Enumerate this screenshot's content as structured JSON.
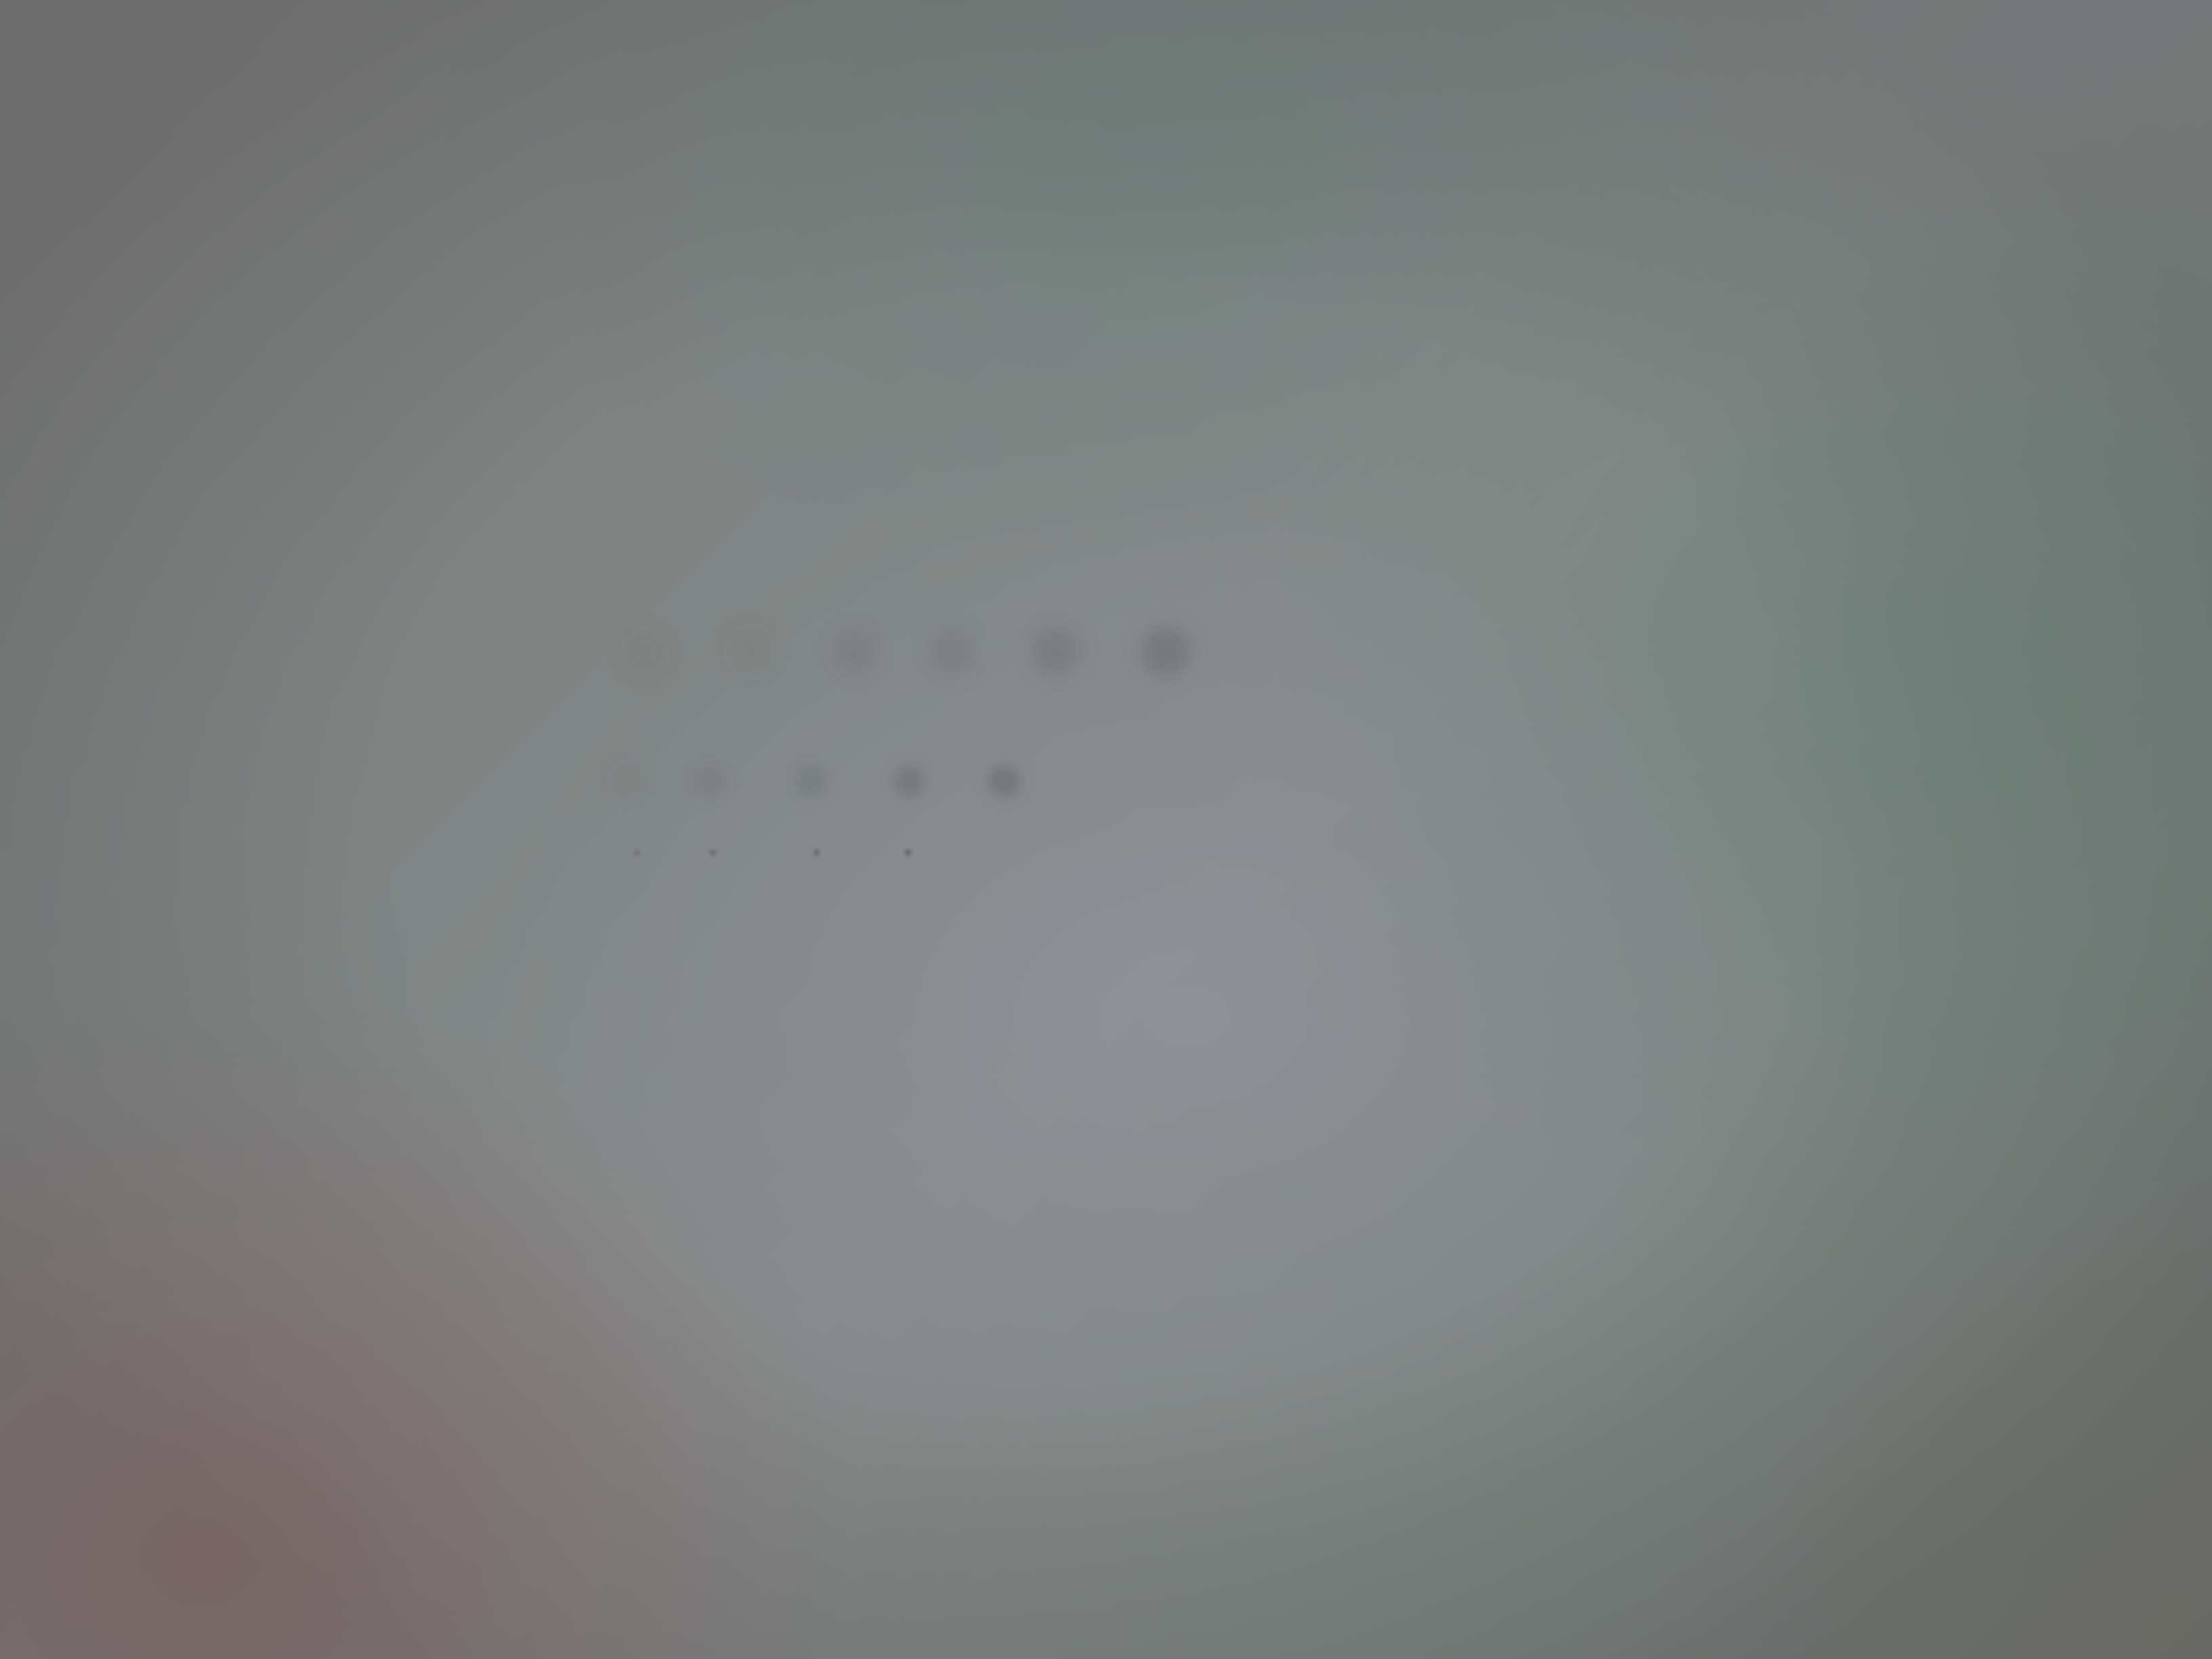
{
  "scene": {
    "description_tags": [
      "blurred-surface",
      "dot-pattern"
    ],
    "colors": {
      "base": "#808585",
      "dot": "#555a5a"
    }
  },
  "dot_rows": [
    {
      "row": "top",
      "dot_count": 6,
      "opacity": [
        0.08,
        0.1,
        0.16,
        0.18,
        0.26,
        0.34
      ]
    },
    {
      "row": "middle",
      "dot_count": 5,
      "opacity": [
        0.1,
        0.16,
        0.24,
        0.32,
        0.42
      ]
    },
    {
      "row": "bottom",
      "dot_count": 4,
      "opacity": [
        0.35,
        0.45,
        0.55,
        0.65
      ]
    }
  ]
}
